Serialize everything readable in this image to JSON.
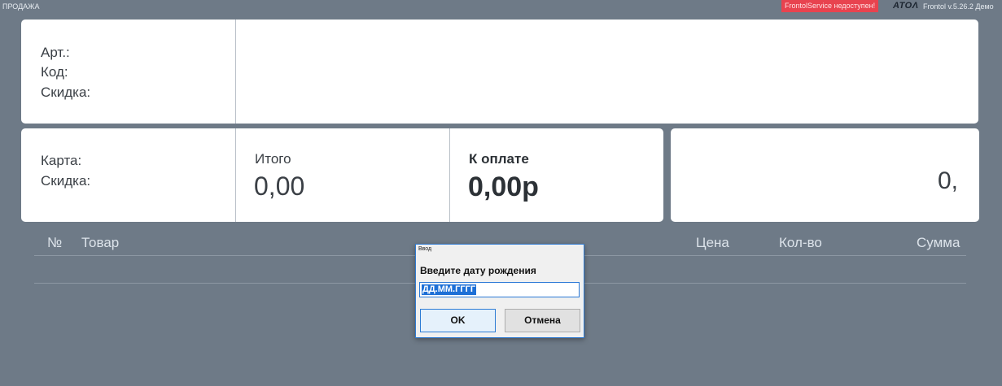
{
  "topbar": {
    "mode": "ПРОДАЖА",
    "warning": "FrontolService недоступен!",
    "logo": "ATOΛ",
    "version": "Frontol v.5.26.2 Демо"
  },
  "item_panel": {
    "article_label": "Арт.:",
    "code_label": "Код:",
    "discount_label": "Скидка:"
  },
  "card_panel": {
    "card_label": "Карта:",
    "discount_label": "Скидка:"
  },
  "totals": {
    "total_label": "Итого",
    "total_value": "0,00",
    "pay_label": "К оплате",
    "pay_value": "0,00р"
  },
  "display": {
    "value": "0,"
  },
  "table": {
    "columns": [
      "№",
      "Товар",
      "Цена",
      "Кол-во",
      "Сумма"
    ]
  },
  "dialog": {
    "title": "Ввод",
    "prompt": "Введите дату рождения",
    "input_value": "ДД.ММ.ГГГГ",
    "ok_label": "OK",
    "cancel_label": "Отмена"
  }
}
